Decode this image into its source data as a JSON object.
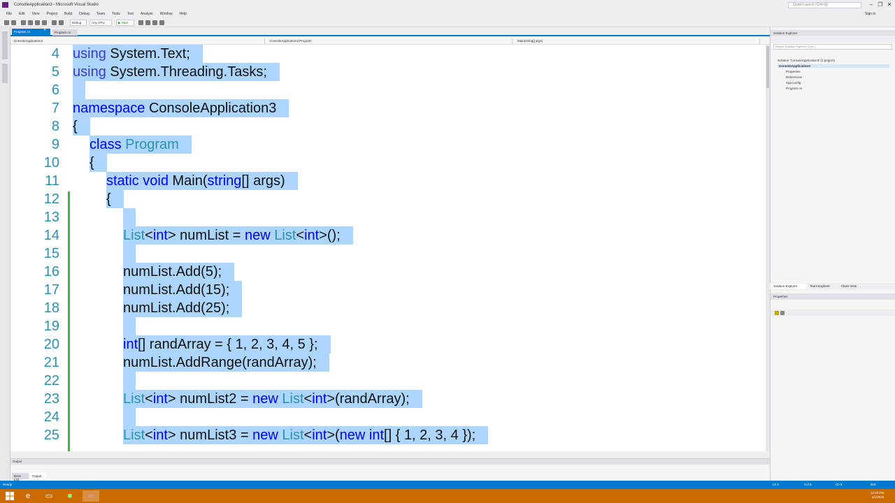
{
  "window": {
    "title": "ConsoleApplication3 - Microsoft Visual Studio",
    "quick_launch_placeholder": "Quick Launch (Ctrl+Q)",
    "controls": [
      "–",
      "❐",
      "✕"
    ],
    "sign_in": "Sign in"
  },
  "menu": [
    "File",
    "Edit",
    "View",
    "Project",
    "Build",
    "Debug",
    "Team",
    "Tools",
    "Test",
    "Analyze",
    "Window",
    "Help"
  ],
  "toolbar": {
    "config": "Debug",
    "platform": "Any CPU",
    "start_label": "▶ Start"
  },
  "document_tabs": {
    "active": "Program.cs",
    "second": "Program.cs"
  },
  "nav_bar": {
    "project": "ConsoleApplication3",
    "class": "ConsoleApplication3.Program",
    "member": "Main(string[] args)"
  },
  "code": {
    "lines": [
      {
        "num": "4",
        "indent": 0,
        "tokens": [
          {
            "t": "using ",
            "c": "kw2"
          },
          {
            "t": "System.Text;",
            "c": "pln"
          }
        ]
      },
      {
        "num": "5",
        "indent": 0,
        "tokens": [
          {
            "t": "using ",
            "c": "kw2"
          },
          {
            "t": "System.Threading.Tasks;",
            "c": "pln"
          }
        ]
      },
      {
        "num": "6",
        "indent": 0,
        "tokens": [
          {
            "t": "",
            "c": "pln"
          }
        ]
      },
      {
        "num": "7",
        "indent": 0,
        "tokens": [
          {
            "t": "namespace ",
            "c": "kw"
          },
          {
            "t": "ConsoleApplication3",
            "c": "pln"
          }
        ]
      },
      {
        "num": "8",
        "indent": 0,
        "tokens": [
          {
            "t": "{",
            "c": "pln"
          }
        ]
      },
      {
        "num": "9",
        "indent": 1,
        "tokens": [
          {
            "t": "class ",
            "c": "kw"
          },
          {
            "t": "Program",
            "c": "typ"
          }
        ]
      },
      {
        "num": "10",
        "indent": 1,
        "tokens": [
          {
            "t": "{",
            "c": "pln"
          }
        ]
      },
      {
        "num": "11",
        "indent": 2,
        "tokens": [
          {
            "t": "static ",
            "c": "kw"
          },
          {
            "t": "void ",
            "c": "kw"
          },
          {
            "t": "Main(",
            "c": "pln"
          },
          {
            "t": "string",
            "c": "kw"
          },
          {
            "t": "[] args)",
            "c": "pln"
          }
        ]
      },
      {
        "num": "12",
        "indent": 2,
        "tokens": [
          {
            "t": "{",
            "c": "pln"
          }
        ]
      },
      {
        "num": "13",
        "indent": 3,
        "tokens": [
          {
            "t": "",
            "c": "pln"
          }
        ]
      },
      {
        "num": "14",
        "indent": 3,
        "tokens": [
          {
            "t": "List",
            "c": "typ"
          },
          {
            "t": "<",
            "c": "pln"
          },
          {
            "t": "int",
            "c": "kw"
          },
          {
            "t": "> numList = ",
            "c": "pln"
          },
          {
            "t": "new ",
            "c": "kw"
          },
          {
            "t": "List",
            "c": "typ"
          },
          {
            "t": "<",
            "c": "pln"
          },
          {
            "t": "int",
            "c": "kw"
          },
          {
            "t": ">();",
            "c": "pln"
          }
        ]
      },
      {
        "num": "15",
        "indent": 3,
        "tokens": [
          {
            "t": "",
            "c": "pln"
          }
        ]
      },
      {
        "num": "16",
        "indent": 3,
        "tokens": [
          {
            "t": "numList.Add(5);",
            "c": "pln"
          }
        ]
      },
      {
        "num": "17",
        "indent": 3,
        "tokens": [
          {
            "t": "numList.Add(15);",
            "c": "pln"
          }
        ]
      },
      {
        "num": "18",
        "indent": 3,
        "tokens": [
          {
            "t": "numList.Add(25);",
            "c": "pln"
          }
        ]
      },
      {
        "num": "19",
        "indent": 3,
        "tokens": [
          {
            "t": "",
            "c": "pln"
          }
        ]
      },
      {
        "num": "20",
        "indent": 3,
        "tokens": [
          {
            "t": "int",
            "c": "kw"
          },
          {
            "t": "[] randArray = { 1, 2, 3, 4, 5 };",
            "c": "pln"
          }
        ]
      },
      {
        "num": "21",
        "indent": 3,
        "tokens": [
          {
            "t": "numList.AddRange(randArray);",
            "c": "pln"
          }
        ]
      },
      {
        "num": "22",
        "indent": 3,
        "tokens": [
          {
            "t": "",
            "c": "pln"
          }
        ]
      },
      {
        "num": "23",
        "indent": 3,
        "tokens": [
          {
            "t": "List",
            "c": "typ"
          },
          {
            "t": "<",
            "c": "pln"
          },
          {
            "t": "int",
            "c": "kw"
          },
          {
            "t": "> numList2 = ",
            "c": "pln"
          },
          {
            "t": "new ",
            "c": "kw"
          },
          {
            "t": "List",
            "c": "typ"
          },
          {
            "t": "<",
            "c": "pln"
          },
          {
            "t": "int",
            "c": "kw"
          },
          {
            "t": ">(randArray);",
            "c": "pln"
          }
        ]
      },
      {
        "num": "24",
        "indent": 3,
        "tokens": [
          {
            "t": "",
            "c": "pln"
          }
        ]
      },
      {
        "num": "25",
        "indent": 3,
        "tokens": [
          {
            "t": "List",
            "c": "typ"
          },
          {
            "t": "<",
            "c": "pln"
          },
          {
            "t": "int",
            "c": "kw"
          },
          {
            "t": "> numList3 = ",
            "c": "pln"
          },
          {
            "t": "new ",
            "c": "kw"
          },
          {
            "t": "List",
            "c": "typ"
          },
          {
            "t": "<",
            "c": "pln"
          },
          {
            "t": "int",
            "c": "kw"
          },
          {
            "t": ">(",
            "c": "pln"
          },
          {
            "t": "new ",
            "c": "kw"
          },
          {
            "t": "int",
            "c": "kw"
          },
          {
            "t": "[] { 1, 2, 3, 4 });",
            "c": "pln"
          }
        ]
      }
    ]
  },
  "output_pane": {
    "title": "Output",
    "tabs": [
      "Error List",
      "Output"
    ]
  },
  "solution_explorer": {
    "title": "Solution Explorer",
    "search_placeholder": "Search Solution Explorer (Ctrl+;)",
    "items": [
      "Solution 'ConsoleApplication3' (1 project)",
      "ConsoleApplication3",
      "Properties",
      "References",
      "App.config",
      "Program.cs"
    ]
  },
  "pane_tabs": [
    "Solution Explorer",
    "Team Explorer",
    "Class View"
  ],
  "properties": {
    "title": "Properties"
  },
  "status_bar": {
    "left": "Ready",
    "ln": "Ln 4",
    "col": "Col 5",
    "ch": "Ch 5",
    "mode": "INS"
  },
  "taskbar": {
    "clock_time": "12:00 PM",
    "clock_date": "1/1/2015"
  },
  "colors": {
    "accent": "#007acc",
    "selection": "#add6ff",
    "keyword": "#0000ff",
    "type": "#2b91af",
    "taskbar": "#cc6a00"
  }
}
